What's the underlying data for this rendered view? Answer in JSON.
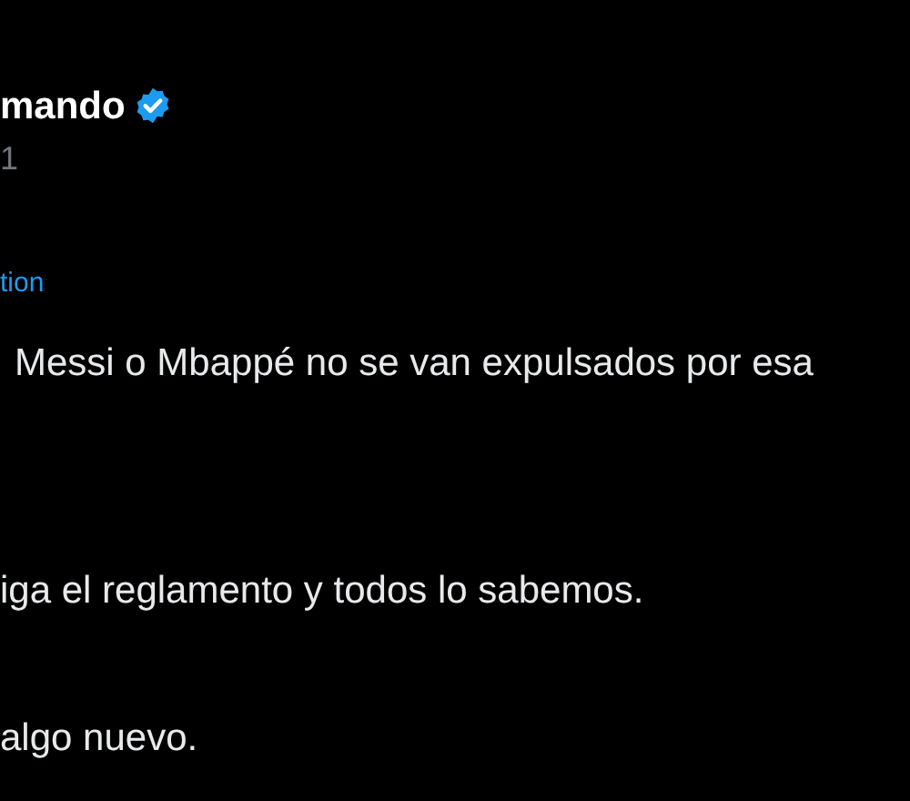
{
  "author": {
    "name": "mando",
    "verified": true,
    "handle": "1"
  },
  "translate_link": "tion",
  "lines": [
    "Messi o Mbappé no se van expulsados por esa",
    "iga el reglamento y todos lo sabemos.",
    "algo nuevo."
  ]
}
